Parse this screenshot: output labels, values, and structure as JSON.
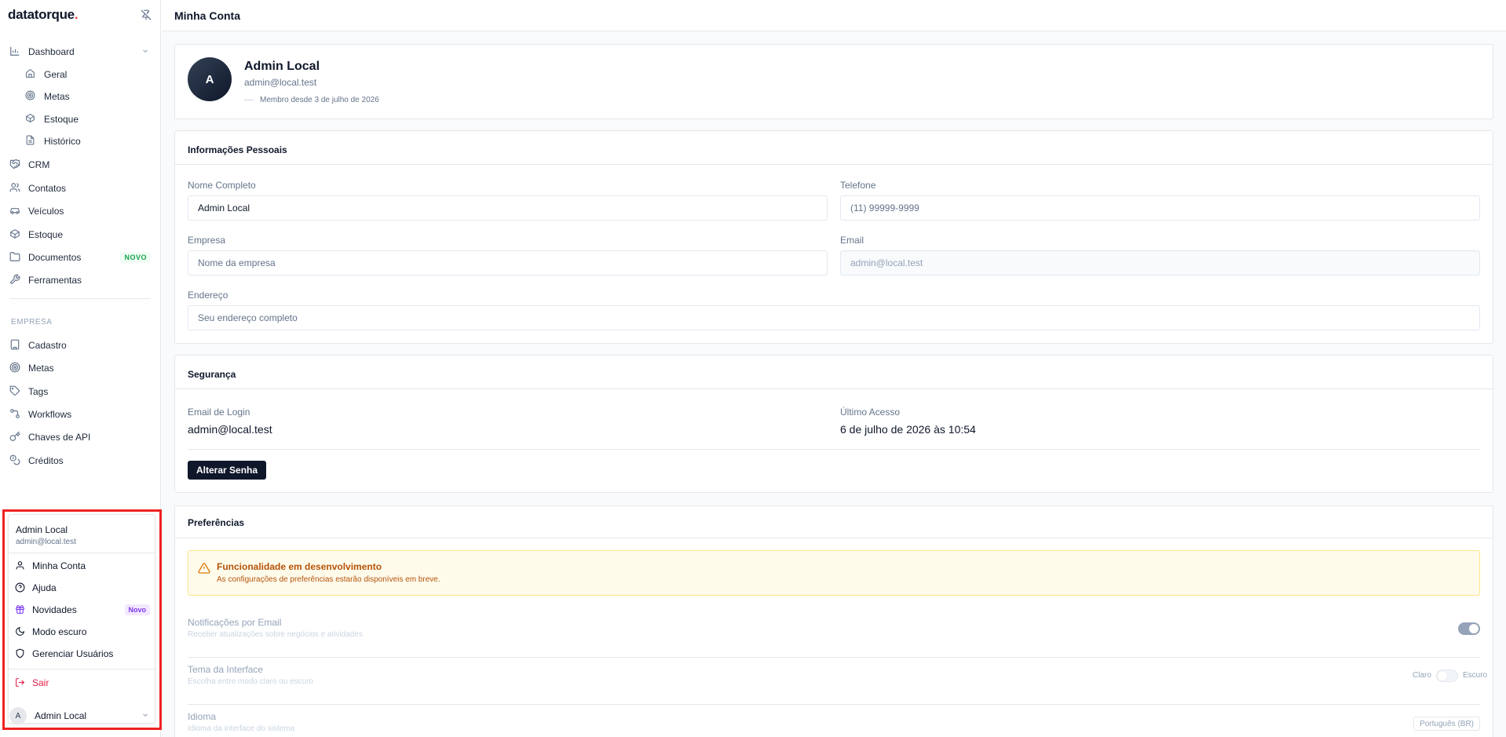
{
  "app": {
    "logo": "datatorque",
    "logo_dot": "."
  },
  "sidebar": {
    "items": [
      {
        "label": "Dashboard"
      },
      {
        "label": "Geral"
      },
      {
        "label": "Metas"
      },
      {
        "label": "Estoque"
      },
      {
        "label": "Histórico"
      },
      {
        "label": "CRM"
      },
      {
        "label": "Contatos"
      },
      {
        "label": "Veículos"
      },
      {
        "label": "Estoque"
      },
      {
        "label": "Documentos",
        "badge": "NOVO"
      },
      {
        "label": "Ferramentas"
      }
    ],
    "section_empresa": "EMPRESA",
    "empresa_items": [
      {
        "label": "Cadastro"
      },
      {
        "label": "Metas"
      },
      {
        "label": "Tags"
      },
      {
        "label": "Workflows"
      },
      {
        "label": "Chaves de API"
      },
      {
        "label": "Créditos"
      }
    ],
    "footer_user": {
      "initial": "A",
      "name": "Admin Local"
    }
  },
  "user_menu": {
    "name": "Admin Local",
    "email": "admin@local.test",
    "items": [
      {
        "label": "Minha Conta"
      },
      {
        "label": "Ajuda"
      },
      {
        "label": "Novidades",
        "badge": "Novo"
      },
      {
        "label": "Modo escuro"
      },
      {
        "label": "Gerenciar Usuários"
      }
    ],
    "logout": "Sair"
  },
  "header": {
    "title": "Minha Conta"
  },
  "profile": {
    "initial": "A",
    "name": "Admin Local",
    "email": "admin@local.test",
    "member_since": "Membro desde 3 de julho de 2026"
  },
  "personal": {
    "title": "Informações Pessoais",
    "full_name_label": "Nome Completo",
    "full_name_value": "Admin Local",
    "phone_label": "Telefone",
    "phone_placeholder": "(11) 99999-9999",
    "company_label": "Empresa",
    "company_placeholder": "Nome da empresa",
    "email_label": "Email",
    "email_value": "admin@local.test",
    "address_label": "Endereço",
    "address_placeholder": "Seu endereço completo"
  },
  "security": {
    "title": "Segurança",
    "login_email_label": "Email de Login",
    "login_email_value": "admin@local.test",
    "last_access_label": "Último Acesso",
    "last_access_value": "6 de julho de 2026 às 10:54",
    "change_password": "Alterar Senha"
  },
  "preferences": {
    "title": "Preferências",
    "alert_title": "Funcionalidade em desenvolvimento",
    "alert_desc": "As configurações de preferências estarão disponíveis em breve.",
    "email_notif_label": "Notificações por Email",
    "email_notif_desc": "Receber atualizações sobre negócios e atividades",
    "email_notif_on": true,
    "theme_label": "Tema da Interface",
    "theme_desc": "Escolha entre modo claro ou escuro",
    "theme_light": "Claro",
    "theme_dark": "Escuro",
    "language_label": "Idioma",
    "language_desc": "Idioma da interface do sistema",
    "language_value": "Português (BR)"
  },
  "colors": {
    "accent": "#0f172a",
    "highlight": "#ef2222",
    "warning": "#b45309",
    "success": "#16a34a",
    "purple": "#7c3aed",
    "danger": "#e11d48"
  }
}
